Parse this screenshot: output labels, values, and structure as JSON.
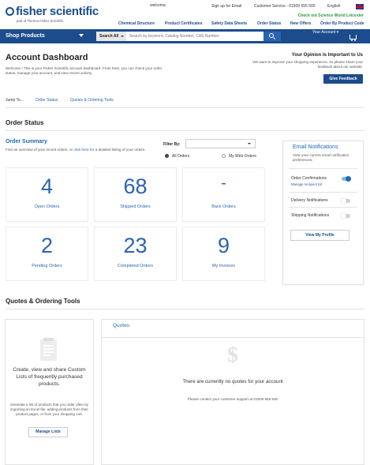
{
  "brand": {
    "name": "fisher scientific",
    "tagline": "part of Thermo Fisher Scientific"
  },
  "topbar": {
    "welcome": "welcome,",
    "signup": "Sign up for Email",
    "customer_service": "Customer Service - 01509 555 500",
    "language": "English",
    "promo": "Check out Science World Leicester"
  },
  "category_nav": [
    "Chemical Structure",
    "Product Certificates",
    "Safety Data Sheets",
    "Order Status",
    "New Offers",
    "Order By Product Code"
  ],
  "search": {
    "shop_products": "Shop Products",
    "scope": "Search All",
    "placeholder": "Search by keyword, Catalog Number, CAS Number",
    "account": "Your Account"
  },
  "dashboard": {
    "title": "Account Dashboard",
    "welcome_text": "Welcome                    ! This is your Fisher Scientific account dashboard. From here, you can check your order status, manage your account, and view recent activity.",
    "opinion_title": "Your Opinion Is Important to Us",
    "opinion_text": "We want to improve your shopping experience, so please share your feedback about our website.",
    "feedback_btn": "Give Feedback",
    "jump_to": "Jump To...",
    "jump_links": [
      "Order Status",
      "Quotes & Ordering Tools"
    ]
  },
  "order_status": {
    "heading": "Order Status",
    "summary_title": "Order Summary",
    "summary_sub_a": "Find an overview of your recent orders, or",
    "summary_sub_link": "click here",
    "summary_sub_b": "for a detailed listing of your orders.",
    "filter_label": "Filter By:",
    "filter_value": "",
    "radio_all": "All Orders",
    "radio_web": "My Web Orders",
    "cards": [
      {
        "value": "4",
        "label": "Open Orders"
      },
      {
        "value": "68",
        "label": "Shipped Orders"
      },
      {
        "value": "-",
        "label": "Back Orders"
      },
      {
        "value": "2",
        "label": "Pending Orders"
      },
      {
        "value": "23",
        "label": "Completed Orders"
      },
      {
        "value": "9",
        "label": "My Invoices"
      }
    ]
  },
  "email_notifications": {
    "title": "Email Notifications",
    "subtitle": "View your current email notification preferences.",
    "rows": [
      {
        "label": "Order Confirmations",
        "on": true,
        "link": "Manage recipient list"
      },
      {
        "label": "Delivery Notifications",
        "on": false
      },
      {
        "label": "Shipping Notifications",
        "on": false
      }
    ],
    "profile_btn": "View My Profile"
  },
  "tools": {
    "heading": "Quotes & Ordering Tools",
    "lists_title": "Create, view and share Custom Lists of frequently purchased products.",
    "lists_text": "Generate a list of products that you order often by importing an Excel file, adding products from their product pages, or from your shopping cart.",
    "lists_btn": "Manage Lists",
    "quotes_title": "Quotes",
    "quotes_empty": "There are currently no quotes for your account",
    "quotes_contact": "Please contact your customer support at 01509 555 500"
  },
  "colors": {
    "navy": "#1c4c8c",
    "link_blue": "#2a63b0",
    "promo_green": "#2e9a3a"
  }
}
